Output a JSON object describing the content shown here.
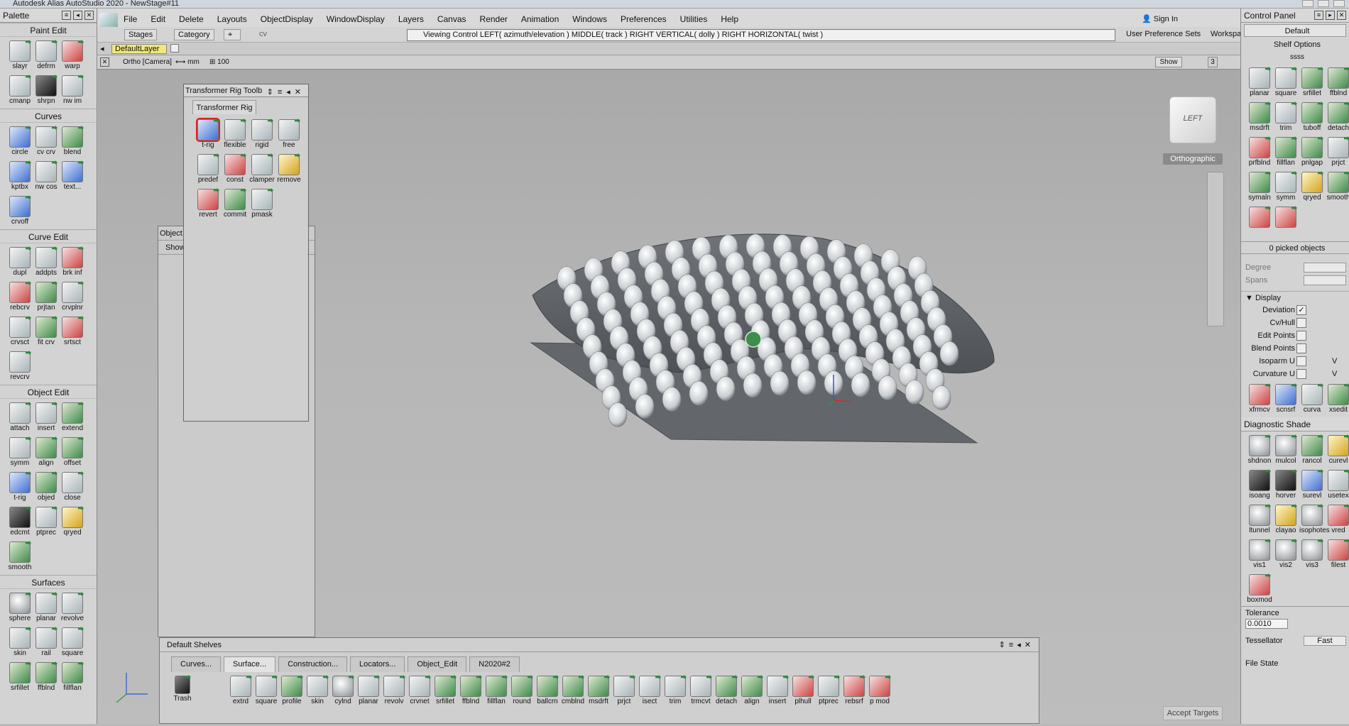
{
  "window": {
    "title": "Autodesk Alias AutoStudio 2020 - NewStage#11"
  },
  "palette": {
    "title": "Palette",
    "sections": [
      {
        "title": "Paint Edit",
        "tools": [
          {
            "label": "slayr",
            "ic": ""
          },
          {
            "label": "defrm",
            "ic": ""
          },
          {
            "label": "warp",
            "ic": "red"
          },
          {
            "label": "cmanp",
            "ic": ""
          },
          {
            "label": "shrpn",
            "ic": "dark"
          },
          {
            "label": "nw im",
            "ic": ""
          }
        ]
      },
      {
        "title": "Curves",
        "tools": [
          {
            "label": "circle",
            "ic": "blue"
          },
          {
            "label": "cv crv",
            "ic": ""
          },
          {
            "label": "blend",
            "ic": "green"
          },
          {
            "label": "kptbx",
            "ic": "blue"
          },
          {
            "label": "nw cos",
            "ic": ""
          },
          {
            "label": "text...",
            "ic": "blue"
          },
          {
            "label": "crvoff",
            "ic": "blue"
          }
        ]
      },
      {
        "title": "Curve Edit",
        "tools": [
          {
            "label": "dupl",
            "ic": ""
          },
          {
            "label": "addpts",
            "ic": ""
          },
          {
            "label": "brk inf",
            "ic": "red"
          },
          {
            "label": "rebcrv",
            "ic": "red"
          },
          {
            "label": "prjtan",
            "ic": "green"
          },
          {
            "label": "crvplnr",
            "ic": ""
          },
          {
            "label": "crvsct",
            "ic": ""
          },
          {
            "label": "fit crv",
            "ic": "green"
          },
          {
            "label": "srtsct",
            "ic": "red"
          },
          {
            "label": "revcrv",
            "ic": ""
          }
        ]
      },
      {
        "title": "Object Edit",
        "tools": [
          {
            "label": "attach",
            "ic": ""
          },
          {
            "label": "insert",
            "ic": ""
          },
          {
            "label": "extend",
            "ic": "green"
          },
          {
            "label": "symm",
            "ic": ""
          },
          {
            "label": "align",
            "ic": "green"
          },
          {
            "label": "offset",
            "ic": "green"
          },
          {
            "label": "t-rig",
            "ic": "blue"
          },
          {
            "label": "objed",
            "ic": "green"
          },
          {
            "label": "close",
            "ic": ""
          },
          {
            "label": "edcmt",
            "ic": "dark"
          },
          {
            "label": "ptprec",
            "ic": ""
          },
          {
            "label": "qryed",
            "ic": "yellow"
          },
          {
            "label": "smooth",
            "ic": "green"
          }
        ]
      },
      {
        "title": "Surfaces",
        "tools": [
          {
            "label": "sphere",
            "ic": "gray"
          },
          {
            "label": "planar",
            "ic": ""
          },
          {
            "label": "revolve",
            "ic": ""
          },
          {
            "label": "skin",
            "ic": ""
          },
          {
            "label": "rail",
            "ic": ""
          },
          {
            "label": "square",
            "ic": ""
          },
          {
            "label": "srfillet",
            "ic": "green"
          },
          {
            "label": "ffblnd",
            "ic": "green"
          },
          {
            "label": "fillflan",
            "ic": "green"
          }
        ]
      }
    ]
  },
  "shelf_left": {
    "label": "t-rig"
  },
  "menubar": [
    "File",
    "Edit",
    "Delete",
    "Layouts",
    "ObjectDisplay",
    "WindowDisplay",
    "Layers",
    "Canvas",
    "Render",
    "Animation",
    "Windows",
    "Preferences",
    "Utilities",
    "Help"
  ],
  "signin": "Sign In",
  "toolbar2": {
    "stages": "Stages",
    "category": "Category",
    "cv": "cv",
    "viewing_control": "Viewing Control    LEFT( azimuth/elevation )    MIDDLE( track )    RIGHT VERTICAL( dolly )    RIGHT HORIZONTAL( twist )",
    "user_pref": "User Preference Sets",
    "workspaces": "Workspaces"
  },
  "layer": {
    "name": "DefaultLayer"
  },
  "viewport": {
    "camera": "Ortho [Camera]",
    "units": "mm",
    "grid": "100",
    "show": "Show",
    "counter": "3",
    "viewcube": "LEFT",
    "projection": "Orthographic"
  },
  "transformer_rig": {
    "title": "Transformer Rig Toolb",
    "tab": "Transformer Rig",
    "tools": [
      {
        "label": "t-rig",
        "ic": "blue",
        "sel": true
      },
      {
        "label": "flexible",
        "ic": ""
      },
      {
        "label": "rigid",
        "ic": ""
      },
      {
        "label": "free",
        "ic": ""
      },
      {
        "label": "predef",
        "ic": ""
      },
      {
        "label": "const",
        "ic": "red"
      },
      {
        "label": "clamper",
        "ic": ""
      },
      {
        "label": "remove",
        "ic": "yellow"
      },
      {
        "label": "revert",
        "ic": "red"
      },
      {
        "label": "commit",
        "ic": "green"
      },
      {
        "label": "pmask",
        "ic": ""
      }
    ]
  },
  "object_panel": {
    "title": "Object",
    "show": "Show"
  },
  "control_panel": {
    "title": "Control Panel",
    "preset": "Default",
    "shelf_options": "Shelf Options",
    "shelf_name": "ssss",
    "tools": [
      {
        "label": "planar",
        "ic": ""
      },
      {
        "label": "square",
        "ic": ""
      },
      {
        "label": "srfillet",
        "ic": "green"
      },
      {
        "label": "ffblnd",
        "ic": "green"
      },
      {
        "label": "msdrft",
        "ic": "green"
      },
      {
        "label": "trim",
        "ic": ""
      },
      {
        "label": "tuboff",
        "ic": "green"
      },
      {
        "label": "detach",
        "ic": "green"
      },
      {
        "label": "prfblnd",
        "ic": "red"
      },
      {
        "label": "fillflan",
        "ic": "green"
      },
      {
        "label": "pnlgap",
        "ic": "green"
      },
      {
        "label": "prjct",
        "ic": ""
      },
      {
        "label": "symaln",
        "ic": "green"
      },
      {
        "label": "symm",
        "ic": ""
      },
      {
        "label": "qryed",
        "ic": "yellow"
      },
      {
        "label": "smooth",
        "ic": "green"
      },
      {
        "label": "",
        "ic": "red"
      },
      {
        "label": "",
        "ic": "red"
      }
    ],
    "picked": "0 picked objects",
    "degree": "Degree",
    "spans": "Spans",
    "display": "Display",
    "display_rows": [
      {
        "label": "Deviation",
        "checked": true
      },
      {
        "label": "Cv/Hull",
        "checked": false
      },
      {
        "label": "Edit Points",
        "checked": false
      },
      {
        "label": "Blend Points",
        "checked": false
      },
      {
        "label": "Isoparm U",
        "checked": false
      },
      {
        "label": "Curvature U",
        "checked": false
      }
    ],
    "v_label": "V",
    "tools2": [
      {
        "label": "xfrmcv",
        "ic": "red"
      },
      {
        "label": "scnsrf",
        "ic": "blue"
      },
      {
        "label": "curva",
        "ic": ""
      },
      {
        "label": "xsedit",
        "ic": "green"
      }
    ],
    "diag_title": "Diagnostic Shade",
    "diag_tools": [
      {
        "label": "shdnon",
        "ic": "gray"
      },
      {
        "label": "mulcol",
        "ic": "gray"
      },
      {
        "label": "rancol",
        "ic": "green"
      },
      {
        "label": "curevl",
        "ic": "yellow"
      },
      {
        "label": "isoang",
        "ic": "dark"
      },
      {
        "label": "horver",
        "ic": "dark"
      },
      {
        "label": "surevl",
        "ic": "blue"
      },
      {
        "label": "usetex",
        "ic": ""
      },
      {
        "label": "ltunnel",
        "ic": "gray"
      },
      {
        "label": "clayao",
        "ic": "yellow"
      },
      {
        "label": "isophotes",
        "ic": "gray"
      },
      {
        "label": "vred",
        "ic": "red"
      },
      {
        "label": "vis1",
        "ic": "gray"
      },
      {
        "label": "vis2",
        "ic": "gray"
      },
      {
        "label": "vis3",
        "ic": "gray"
      },
      {
        "label": "filest",
        "ic": "red"
      },
      {
        "label": "boxmod",
        "ic": "red"
      }
    ],
    "tolerance": "Tolerance",
    "tolerance_value": "0.0010",
    "tessellator": "Tessellator",
    "tessellator_value": "Fast",
    "file_state": "File State"
  },
  "shelves": {
    "title": "Default Shelves",
    "tabs": [
      "Curves...",
      "Surface...",
      "Construction...",
      "Locators...",
      "Object_Edit",
      "N2020#2"
    ],
    "active_tab": 1,
    "trash": "Trash",
    "tools": [
      {
        "label": "extrd",
        "ic": ""
      },
      {
        "label": "square",
        "ic": ""
      },
      {
        "label": "profile",
        "ic": "green"
      },
      {
        "label": "skin",
        "ic": ""
      },
      {
        "label": "cylnd",
        "ic": "gray"
      },
      {
        "label": "planar",
        "ic": ""
      },
      {
        "label": "revolv",
        "ic": ""
      },
      {
        "label": "crvnet",
        "ic": ""
      },
      {
        "label": "srfillet",
        "ic": "green"
      },
      {
        "label": "ffblnd",
        "ic": "green"
      },
      {
        "label": "fillflan",
        "ic": "green"
      },
      {
        "label": "round",
        "ic": "green"
      },
      {
        "label": "ballcrn",
        "ic": "green"
      },
      {
        "label": "cmblnd",
        "ic": "green"
      },
      {
        "label": "msdrft",
        "ic": "green"
      },
      {
        "label": "prjct",
        "ic": ""
      },
      {
        "label": "isect",
        "ic": ""
      },
      {
        "label": "trim",
        "ic": ""
      },
      {
        "label": "trmcvt",
        "ic": ""
      },
      {
        "label": "detach",
        "ic": "green"
      },
      {
        "label": "align",
        "ic": "green"
      },
      {
        "label": "insert",
        "ic": ""
      },
      {
        "label": "plhull",
        "ic": "red"
      },
      {
        "label": "ptprec",
        "ic": ""
      },
      {
        "label": "rebsrf",
        "ic": "red"
      },
      {
        "label": "p mod",
        "ic": "red"
      }
    ]
  },
  "accept_targets": "Accept Targets",
  "colors": {
    "accent_selected": "#e02020",
    "layer_bg": "#efe97a",
    "viewport_bg": "#b6b6b6"
  }
}
